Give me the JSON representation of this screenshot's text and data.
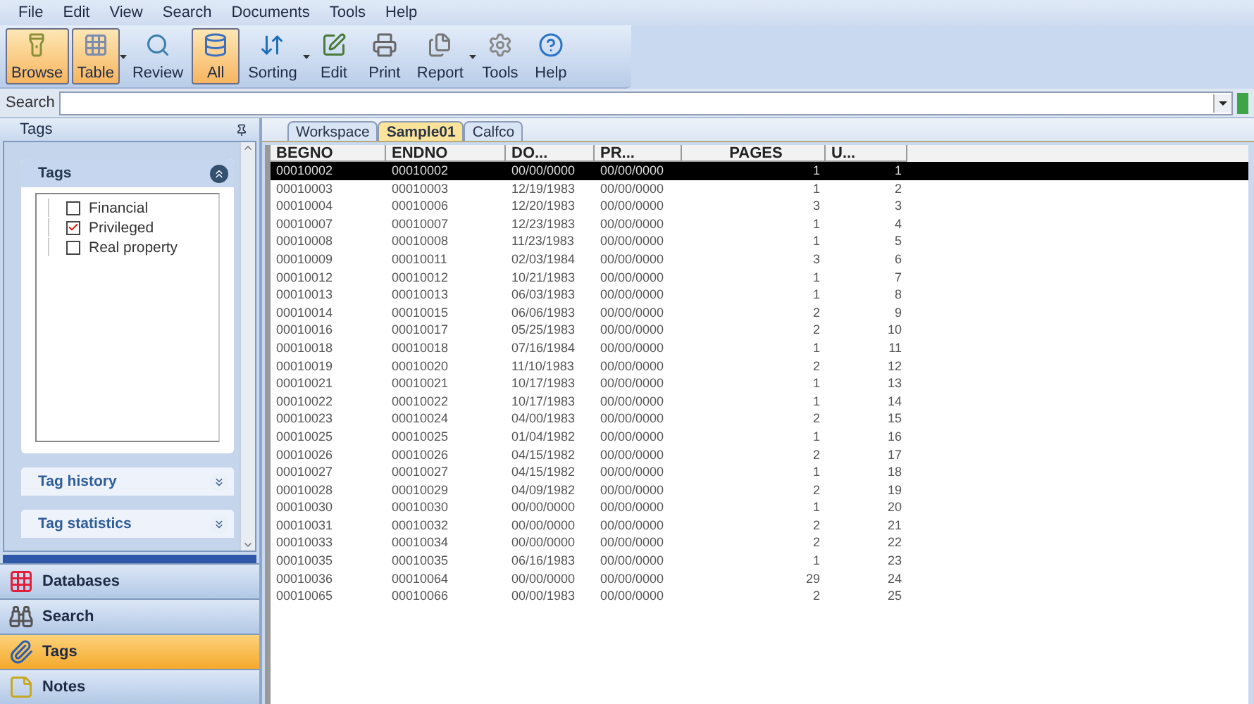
{
  "menu": [
    "File",
    "Edit",
    "View",
    "Search",
    "Documents",
    "Tools",
    "Help"
  ],
  "toolbar": [
    {
      "label": "Browse",
      "selected": true,
      "dropdown": false
    },
    {
      "label": "Table",
      "selected": true,
      "dropdown": true
    },
    {
      "label": "Review",
      "selected": false,
      "dropdown": false
    },
    {
      "label": "All",
      "selected": true,
      "dropdown": false
    },
    {
      "label": "Sorting",
      "selected": false,
      "dropdown": true
    },
    {
      "label": "Edit",
      "selected": false,
      "dropdown": false
    },
    {
      "label": "Print",
      "selected": false,
      "dropdown": false
    },
    {
      "label": "Report",
      "selected": false,
      "dropdown": true
    },
    {
      "label": "Tools",
      "selected": false,
      "dropdown": false
    },
    {
      "label": "Help",
      "selected": false,
      "dropdown": false
    }
  ],
  "search": {
    "label": "Search"
  },
  "sidebar": {
    "title": "Tags",
    "sections": [
      {
        "title": "Tags",
        "expanded": true,
        "tags": [
          {
            "label": "Financial",
            "checked": false
          },
          {
            "label": "Privileged",
            "checked": true
          },
          {
            "label": "Real property",
            "checked": false
          }
        ]
      },
      {
        "title": "Tag history",
        "expanded": false
      },
      {
        "title": "Tag statistics",
        "expanded": false
      }
    ],
    "nav": [
      {
        "label": "Databases",
        "selected": false
      },
      {
        "label": "Search",
        "selected": false
      },
      {
        "label": "Tags",
        "selected": true
      },
      {
        "label": "Notes",
        "selected": false
      }
    ]
  },
  "tabs": [
    {
      "label": "Workspace",
      "selected": false
    },
    {
      "label": "Sample01",
      "selected": true
    },
    {
      "label": "Calfco",
      "selected": false
    }
  ],
  "table": {
    "columns": [
      "BEGNO",
      "ENDNO",
      "DO...",
      "PR...",
      "PAGES",
      "U..."
    ],
    "rows": [
      {
        "selected": true,
        "cells": [
          "00010002",
          "00010002",
          "00/00/0000",
          "00/00/0000",
          "1",
          "1"
        ]
      },
      {
        "selected": false,
        "cells": [
          "00010003",
          "00010003",
          "12/19/1983",
          "00/00/0000",
          "1",
          "2"
        ]
      },
      {
        "selected": false,
        "cells": [
          "00010004",
          "00010006",
          "12/20/1983",
          "00/00/0000",
          "3",
          "3"
        ]
      },
      {
        "selected": false,
        "cells": [
          "00010007",
          "00010007",
          "12/23/1983",
          "00/00/0000",
          "1",
          "4"
        ]
      },
      {
        "selected": false,
        "cells": [
          "00010008",
          "00010008",
          "11/23/1983",
          "00/00/0000",
          "1",
          "5"
        ]
      },
      {
        "selected": false,
        "cells": [
          "00010009",
          "00010011",
          "02/03/1984",
          "00/00/0000",
          "3",
          "6"
        ]
      },
      {
        "selected": false,
        "cells": [
          "00010012",
          "00010012",
          "10/21/1983",
          "00/00/0000",
          "1",
          "7"
        ]
      },
      {
        "selected": false,
        "cells": [
          "00010013",
          "00010013",
          "06/03/1983",
          "00/00/0000",
          "1",
          "8"
        ]
      },
      {
        "selected": false,
        "cells": [
          "00010014",
          "00010015",
          "06/06/1983",
          "00/00/0000",
          "2",
          "9"
        ]
      },
      {
        "selected": false,
        "cells": [
          "00010016",
          "00010017",
          "05/25/1983",
          "00/00/0000",
          "2",
          "10"
        ]
      },
      {
        "selected": false,
        "cells": [
          "00010018",
          "00010018",
          "07/16/1984",
          "00/00/0000",
          "1",
          "11"
        ]
      },
      {
        "selected": false,
        "cells": [
          "00010019",
          "00010020",
          "11/10/1983",
          "00/00/0000",
          "2",
          "12"
        ]
      },
      {
        "selected": false,
        "cells": [
          "00010021",
          "00010021",
          "10/17/1983",
          "00/00/0000",
          "1",
          "13"
        ]
      },
      {
        "selected": false,
        "cells": [
          "00010022",
          "00010022",
          "10/17/1983",
          "00/00/0000",
          "1",
          "14"
        ]
      },
      {
        "selected": false,
        "cells": [
          "00010023",
          "00010024",
          "04/00/1983",
          "00/00/0000",
          "2",
          "15"
        ]
      },
      {
        "selected": false,
        "cells": [
          "00010025",
          "00010025",
          "01/04/1982",
          "00/00/0000",
          "1",
          "16"
        ]
      },
      {
        "selected": false,
        "cells": [
          "00010026",
          "00010026",
          "04/15/1982",
          "00/00/0000",
          "2",
          "17"
        ]
      },
      {
        "selected": false,
        "cells": [
          "00010027",
          "00010027",
          "04/15/1982",
          "00/00/0000",
          "1",
          "18"
        ]
      },
      {
        "selected": false,
        "cells": [
          "00010028",
          "00010029",
          "04/09/1982",
          "00/00/0000",
          "2",
          "19"
        ]
      },
      {
        "selected": false,
        "cells": [
          "00010030",
          "00010030",
          "00/00/0000",
          "00/00/0000",
          "1",
          "20"
        ]
      },
      {
        "selected": false,
        "cells": [
          "00010031",
          "00010032",
          "00/00/0000",
          "00/00/0000",
          "2",
          "21"
        ]
      },
      {
        "selected": false,
        "cells": [
          "00010033",
          "00010034",
          "00/00/0000",
          "00/00/0000",
          "2",
          "22"
        ]
      },
      {
        "selected": false,
        "cells": [
          "00010035",
          "00010035",
          "06/16/1983",
          "00/00/0000",
          "1",
          "23"
        ]
      },
      {
        "selected": false,
        "cells": [
          "00010036",
          "00010064",
          "00/00/0000",
          "00/00/0000",
          "29",
          "24"
        ]
      },
      {
        "selected": false,
        "cells": [
          "00010065",
          "00010066",
          "00/00/1983",
          "00/00/0000",
          "2",
          "25"
        ]
      }
    ]
  }
}
